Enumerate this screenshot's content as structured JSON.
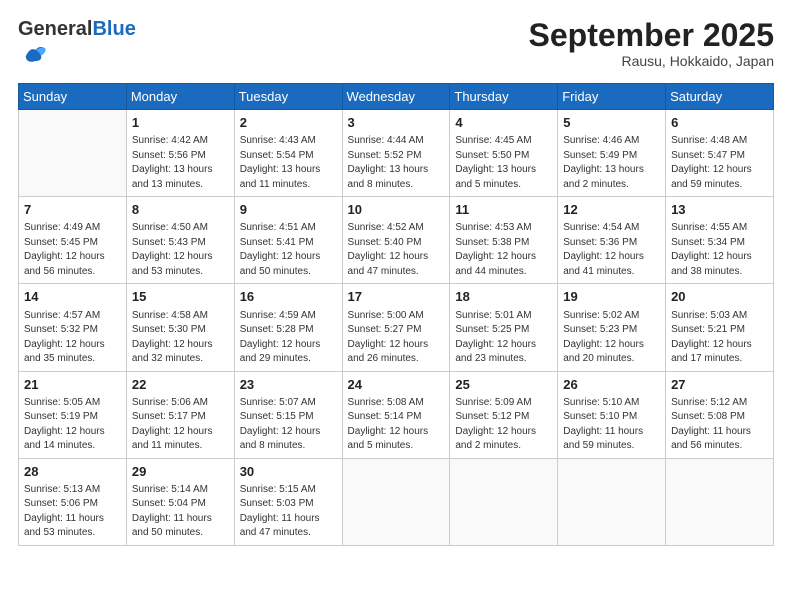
{
  "logo": {
    "general": "General",
    "blue": "Blue"
  },
  "header": {
    "month": "September 2025",
    "location": "Rausu, Hokkaido, Japan"
  },
  "weekdays": [
    "Sunday",
    "Monday",
    "Tuesday",
    "Wednesday",
    "Thursday",
    "Friday",
    "Saturday"
  ],
  "weeks": [
    [
      {
        "day": "",
        "info": ""
      },
      {
        "day": "1",
        "info": "Sunrise: 4:42 AM\nSunset: 5:56 PM\nDaylight: 13 hours\nand 13 minutes."
      },
      {
        "day": "2",
        "info": "Sunrise: 4:43 AM\nSunset: 5:54 PM\nDaylight: 13 hours\nand 11 minutes."
      },
      {
        "day": "3",
        "info": "Sunrise: 4:44 AM\nSunset: 5:52 PM\nDaylight: 13 hours\nand 8 minutes."
      },
      {
        "day": "4",
        "info": "Sunrise: 4:45 AM\nSunset: 5:50 PM\nDaylight: 13 hours\nand 5 minutes."
      },
      {
        "day": "5",
        "info": "Sunrise: 4:46 AM\nSunset: 5:49 PM\nDaylight: 13 hours\nand 2 minutes."
      },
      {
        "day": "6",
        "info": "Sunrise: 4:48 AM\nSunset: 5:47 PM\nDaylight: 12 hours\nand 59 minutes."
      }
    ],
    [
      {
        "day": "7",
        "info": "Sunrise: 4:49 AM\nSunset: 5:45 PM\nDaylight: 12 hours\nand 56 minutes."
      },
      {
        "day": "8",
        "info": "Sunrise: 4:50 AM\nSunset: 5:43 PM\nDaylight: 12 hours\nand 53 minutes."
      },
      {
        "day": "9",
        "info": "Sunrise: 4:51 AM\nSunset: 5:41 PM\nDaylight: 12 hours\nand 50 minutes."
      },
      {
        "day": "10",
        "info": "Sunrise: 4:52 AM\nSunset: 5:40 PM\nDaylight: 12 hours\nand 47 minutes."
      },
      {
        "day": "11",
        "info": "Sunrise: 4:53 AM\nSunset: 5:38 PM\nDaylight: 12 hours\nand 44 minutes."
      },
      {
        "day": "12",
        "info": "Sunrise: 4:54 AM\nSunset: 5:36 PM\nDaylight: 12 hours\nand 41 minutes."
      },
      {
        "day": "13",
        "info": "Sunrise: 4:55 AM\nSunset: 5:34 PM\nDaylight: 12 hours\nand 38 minutes."
      }
    ],
    [
      {
        "day": "14",
        "info": "Sunrise: 4:57 AM\nSunset: 5:32 PM\nDaylight: 12 hours\nand 35 minutes."
      },
      {
        "day": "15",
        "info": "Sunrise: 4:58 AM\nSunset: 5:30 PM\nDaylight: 12 hours\nand 32 minutes."
      },
      {
        "day": "16",
        "info": "Sunrise: 4:59 AM\nSunset: 5:28 PM\nDaylight: 12 hours\nand 29 minutes."
      },
      {
        "day": "17",
        "info": "Sunrise: 5:00 AM\nSunset: 5:27 PM\nDaylight: 12 hours\nand 26 minutes."
      },
      {
        "day": "18",
        "info": "Sunrise: 5:01 AM\nSunset: 5:25 PM\nDaylight: 12 hours\nand 23 minutes."
      },
      {
        "day": "19",
        "info": "Sunrise: 5:02 AM\nSunset: 5:23 PM\nDaylight: 12 hours\nand 20 minutes."
      },
      {
        "day": "20",
        "info": "Sunrise: 5:03 AM\nSunset: 5:21 PM\nDaylight: 12 hours\nand 17 minutes."
      }
    ],
    [
      {
        "day": "21",
        "info": "Sunrise: 5:05 AM\nSunset: 5:19 PM\nDaylight: 12 hours\nand 14 minutes."
      },
      {
        "day": "22",
        "info": "Sunrise: 5:06 AM\nSunset: 5:17 PM\nDaylight: 12 hours\nand 11 minutes."
      },
      {
        "day": "23",
        "info": "Sunrise: 5:07 AM\nSunset: 5:15 PM\nDaylight: 12 hours\nand 8 minutes."
      },
      {
        "day": "24",
        "info": "Sunrise: 5:08 AM\nSunset: 5:14 PM\nDaylight: 12 hours\nand 5 minutes."
      },
      {
        "day": "25",
        "info": "Sunrise: 5:09 AM\nSunset: 5:12 PM\nDaylight: 12 hours\nand 2 minutes."
      },
      {
        "day": "26",
        "info": "Sunrise: 5:10 AM\nSunset: 5:10 PM\nDaylight: 11 hours\nand 59 minutes."
      },
      {
        "day": "27",
        "info": "Sunrise: 5:12 AM\nSunset: 5:08 PM\nDaylight: 11 hours\nand 56 minutes."
      }
    ],
    [
      {
        "day": "28",
        "info": "Sunrise: 5:13 AM\nSunset: 5:06 PM\nDaylight: 11 hours\nand 53 minutes."
      },
      {
        "day": "29",
        "info": "Sunrise: 5:14 AM\nSunset: 5:04 PM\nDaylight: 11 hours\nand 50 minutes."
      },
      {
        "day": "30",
        "info": "Sunrise: 5:15 AM\nSunset: 5:03 PM\nDaylight: 11 hours\nand 47 minutes."
      },
      {
        "day": "",
        "info": ""
      },
      {
        "day": "",
        "info": ""
      },
      {
        "day": "",
        "info": ""
      },
      {
        "day": "",
        "info": ""
      }
    ]
  ]
}
